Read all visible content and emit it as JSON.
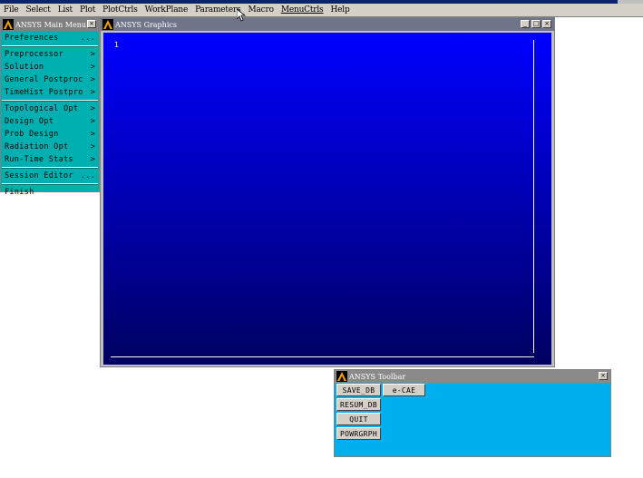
{
  "menubar": {
    "items": [
      "File",
      "Select",
      "List",
      "Plot",
      "PlotCtrls",
      "WorkPlane",
      "Parameters",
      "Macro",
      "MenuCtrls",
      "Help"
    ]
  },
  "main_menu": {
    "title": "ANSYS Main Menu",
    "close": "×",
    "items": [
      {
        "label": "Preferences",
        "suffix": "..."
      },
      {
        "label": "Preprocessor",
        "suffix": ">"
      },
      {
        "label": "Solution",
        "suffix": ">"
      },
      {
        "label": "General Postproc",
        "suffix": ">"
      },
      {
        "label": "TimeHist Postpro",
        "suffix": ">"
      },
      {
        "label": "Topological Opt",
        "suffix": ">"
      },
      {
        "label": "Design Opt",
        "suffix": ">"
      },
      {
        "label": "Prob Design",
        "suffix": ">"
      },
      {
        "label": "Radiation Opt",
        "suffix": ">"
      },
      {
        "label": "Run-Time Stats",
        "suffix": ">"
      },
      {
        "label": "Session Editor",
        "suffix": "..."
      },
      {
        "label": "Finish",
        "suffix": ""
      }
    ]
  },
  "graphics": {
    "title": "ANSYS Graphics",
    "viewport_label": "1",
    "btn_min": "_",
    "btn_max": "□",
    "btn_close": "×"
  },
  "toolbar": {
    "title": "ANSYS Toolbar",
    "close": "×",
    "buttons": [
      "SAVE_DB",
      "e-CAE",
      "RESUM_DB",
      "QUIT",
      "POWRGRPH"
    ]
  },
  "colors": {
    "graphics_top": "#0000ff",
    "graphics_bottom": "#000060",
    "main_menu_bg": "#00b0b0",
    "toolbar_bg": "#00b0ee"
  }
}
